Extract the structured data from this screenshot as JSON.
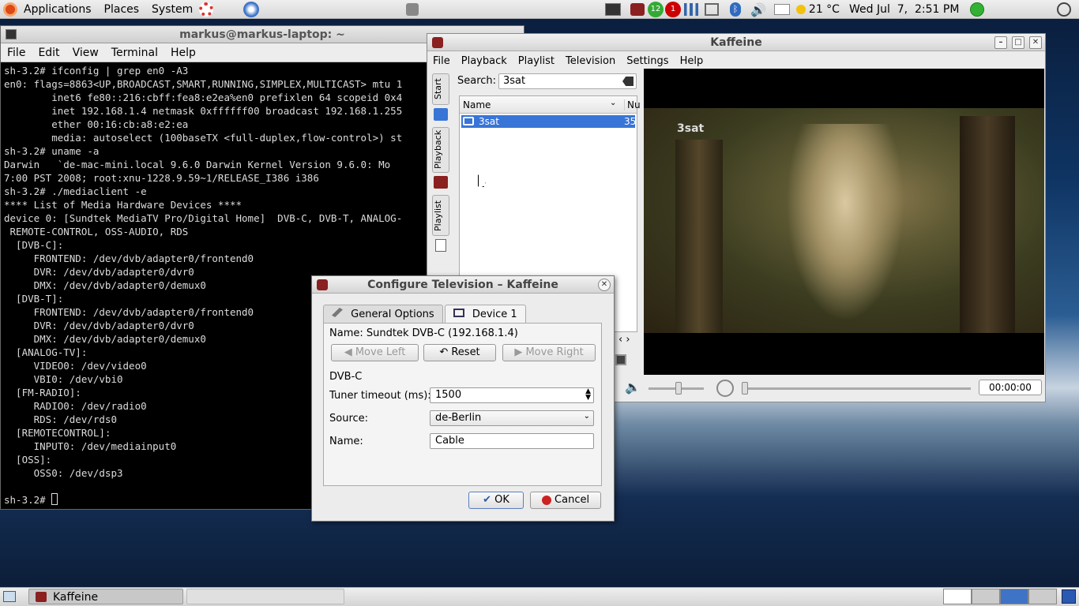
{
  "top_panel": {
    "menus": [
      "Applications",
      "Places",
      "System"
    ],
    "notif_badges": [
      "12",
      "1"
    ],
    "weather": "21 °C",
    "clock": "Wed Jul  7,  2:51 PM"
  },
  "terminal": {
    "title": "markus@markus-laptop: ~",
    "menu": [
      "File",
      "Edit",
      "View",
      "Terminal",
      "Help"
    ],
    "lines": [
      "sh-3.2# ifconfig | grep en0 -A3",
      "en0: flags=8863<UP,BROADCAST,SMART,RUNNING,SIMPLEX,MULTICAST> mtu 1",
      "        inet6 fe80::216:cbff:fea8:e2ea%en0 prefixlen 64 scopeid 0x4",
      "        inet 192.168.1.4 netmask 0xffffff00 broadcast 192.168.1.255",
      "        ether 00:16:cb:a8:e2:ea",
      "        media: autoselect (100baseTX <full-duplex,flow-control>) st",
      "sh-3.2# uname -a",
      "Darwin   `de-mac-mini.local 9.6.0 Darwin Kernel Version 9.6.0: Mo",
      "7:00 PST 2008; root:xnu-1228.9.59~1/RELEASE_I386 i386",
      "sh-3.2# ./mediaclient -e",
      "**** List of Media Hardware Devices ****",
      "device 0: [Sundtek MediaTV Pro/Digital Home]  DVB-C, DVB-T, ANALOG-",
      " REMOTE-CONTROL, OSS-AUDIO, RDS",
      "  [DVB-C]:",
      "     FRONTEND: /dev/dvb/adapter0/frontend0",
      "     DVR: /dev/dvb/adapter0/dvr0",
      "     DMX: /dev/dvb/adapter0/demux0",
      "  [DVB-T]:",
      "     FRONTEND: /dev/dvb/adapter0/frontend0",
      "     DVR: /dev/dvb/adapter0/dvr0",
      "     DMX: /dev/dvb/adapter0/demux0",
      "  [ANALOG-TV]:",
      "     VIDEO0: /dev/video0",
      "     VBI0: /dev/vbi0",
      "  [FM-RADIO]:",
      "     RADIO0: /dev/radio0",
      "     RDS: /dev/rds0",
      "  [REMOTECONTROL]:",
      "     INPUT0: /dev/mediainput0",
      "  [OSS]:",
      "     OSS0: /dev/dsp3",
      "",
      "sh-3.2# "
    ]
  },
  "kaffeine": {
    "title": "Kaffeine",
    "menu": [
      "File",
      "Playback",
      "Playlist",
      "Television",
      "Settings",
      "Help"
    ],
    "side_tabs": [
      "Start",
      "Playback",
      "Playlist"
    ],
    "search_label": "Search:",
    "search_value": "3sat",
    "columns": [
      "Name",
      "Nu"
    ],
    "channel": {
      "name": "3sat",
      "number": "35"
    },
    "osd_channel": "3sat",
    "time": "00:00:00",
    "seek_position": 0.0
  },
  "dialog": {
    "title": "Configure Television – Kaffeine",
    "tabs": [
      "General Options",
      "Device 1"
    ],
    "device_name": "Name: Sundtek DVB-C (192.168.1.4)",
    "move_left": "Move Left",
    "reset": "Reset",
    "move_right": "Move Right",
    "section": "DVB-C",
    "tuner_label": "Tuner timeout (ms):",
    "tuner_value": "1500",
    "source_label": "Source:",
    "source_value": "de-Berlin",
    "name_label": "Name:",
    "name_value": "Cable",
    "ok": "OK",
    "cancel": "Cancel"
  },
  "taskbar": {
    "task": "Kaffeine"
  }
}
